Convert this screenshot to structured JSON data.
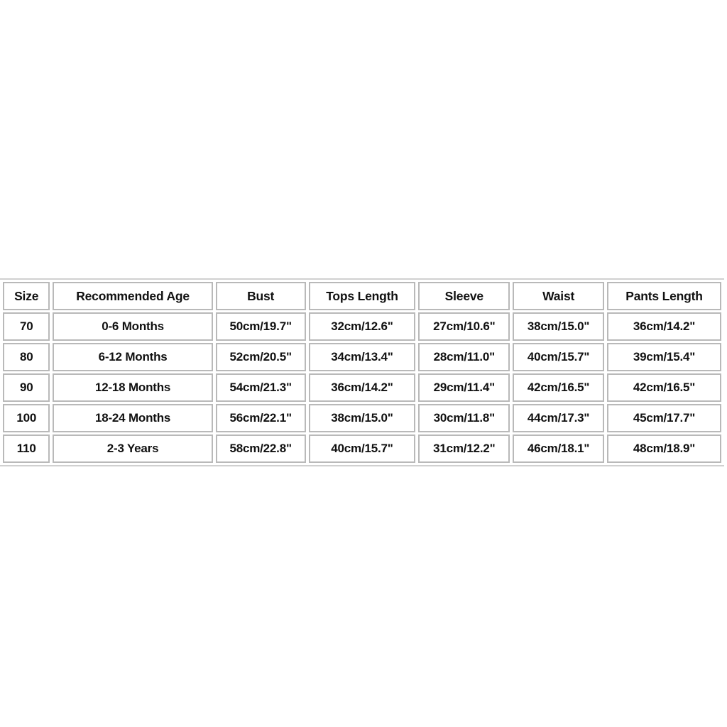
{
  "page": {
    "background_color": "#ffffff",
    "text_color": "#111111",
    "cell_border_color": "#b9b9b9"
  },
  "chart_data": {
    "type": "table",
    "title": "",
    "columns": [
      "Size",
      "Recommended Age",
      "Bust",
      "Tops Length",
      "Sleeve",
      "Waist",
      "Pants Length"
    ],
    "rows": [
      [
        "70",
        "0-6 Months",
        "50cm/19.7\"",
        "32cm/12.6\"",
        "27cm/10.6\"",
        "38cm/15.0\"",
        "36cm/14.2\""
      ],
      [
        "80",
        "6-12 Months",
        "52cm/20.5\"",
        "34cm/13.4\"",
        "28cm/11.0\"",
        "40cm/15.7\"",
        "39cm/15.4\""
      ],
      [
        "90",
        "12-18 Months",
        "54cm/21.3\"",
        "36cm/14.2\"",
        "29cm/11.4\"",
        "42cm/16.5\"",
        "42cm/16.5\""
      ],
      [
        "100",
        "18-24 Months",
        "56cm/22.1\"",
        "38cm/15.0\"",
        "30cm/11.8\"",
        "44cm/17.3\"",
        "45cm/17.7\""
      ],
      [
        "110",
        "2-3 Years",
        "58cm/22.8\"",
        "40cm/15.7\"",
        "31cm/12.2\"",
        "46cm/18.1\"",
        "48cm/18.9\""
      ]
    ]
  }
}
